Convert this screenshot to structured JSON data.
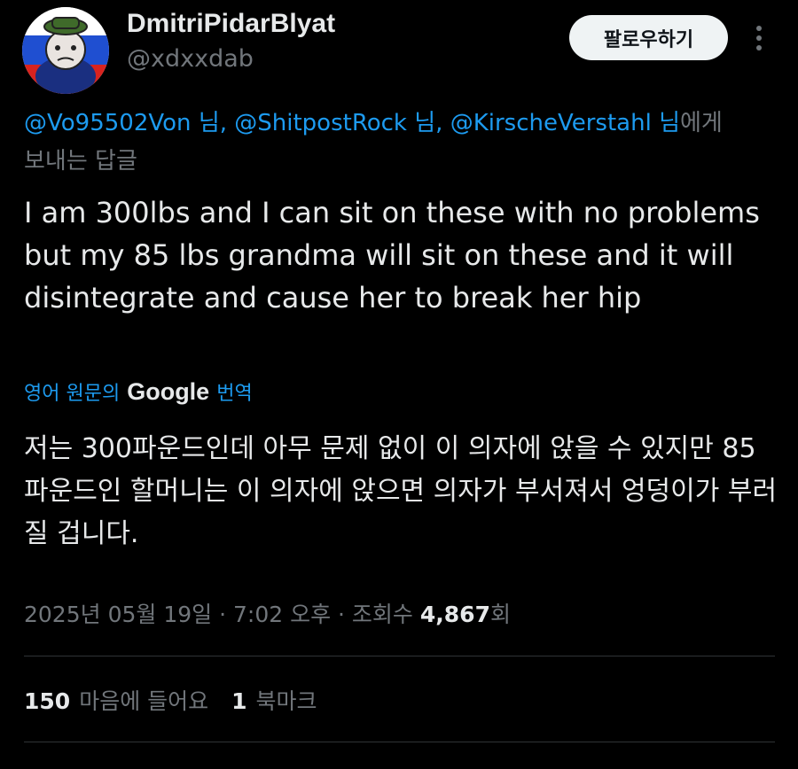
{
  "user": {
    "display_name": "DmitriPidarBlyat",
    "handle": "@xdxxdab",
    "avatar": "avatar-icon"
  },
  "follow_button": {
    "label": "팔로우하기"
  },
  "more_menu": {
    "icon": "more-vertical-icon"
  },
  "reply_to": {
    "mentions": [
      "@Vo95502Von",
      "@ShitpostRock",
      "@KirscheVerstahl"
    ],
    "suffix": "님",
    "separator": ", ",
    "tail": "에게",
    "line2": "보내는 답글"
  },
  "tweet": {
    "text": "I am 300lbs and I can sit on these with no problems but my 85 lbs grandma will sit on these and it will disintegrate and cause her to break her hip"
  },
  "translation": {
    "prefix": "영어 원문의",
    "brand": "Google",
    "suffix": "번역",
    "text": "저는 300파운드인데 아무 문제 없이 이 의자에 앉을 수 있지만 85파운드인 할머니는 이 의자에 앉으면 의자가 부서져서 엉덩이가 부러질 겁니다."
  },
  "meta": {
    "date": "2025년 05월 19일",
    "sep1": " · ",
    "time": "7:02 오후",
    "sep2": " · ",
    "views_label": "조회수",
    "views_count": "4,867",
    "views_suffix": "회"
  },
  "stats": {
    "likes_count": "150",
    "likes_label": "마음에 들어요",
    "bookmarks_count": "1",
    "bookmarks_label": "북마크"
  },
  "colors": {
    "background": "#000000",
    "text": "#e7e9ea",
    "secondary": "#71767b",
    "link": "#1d9bf0",
    "divider": "#2f3336"
  }
}
